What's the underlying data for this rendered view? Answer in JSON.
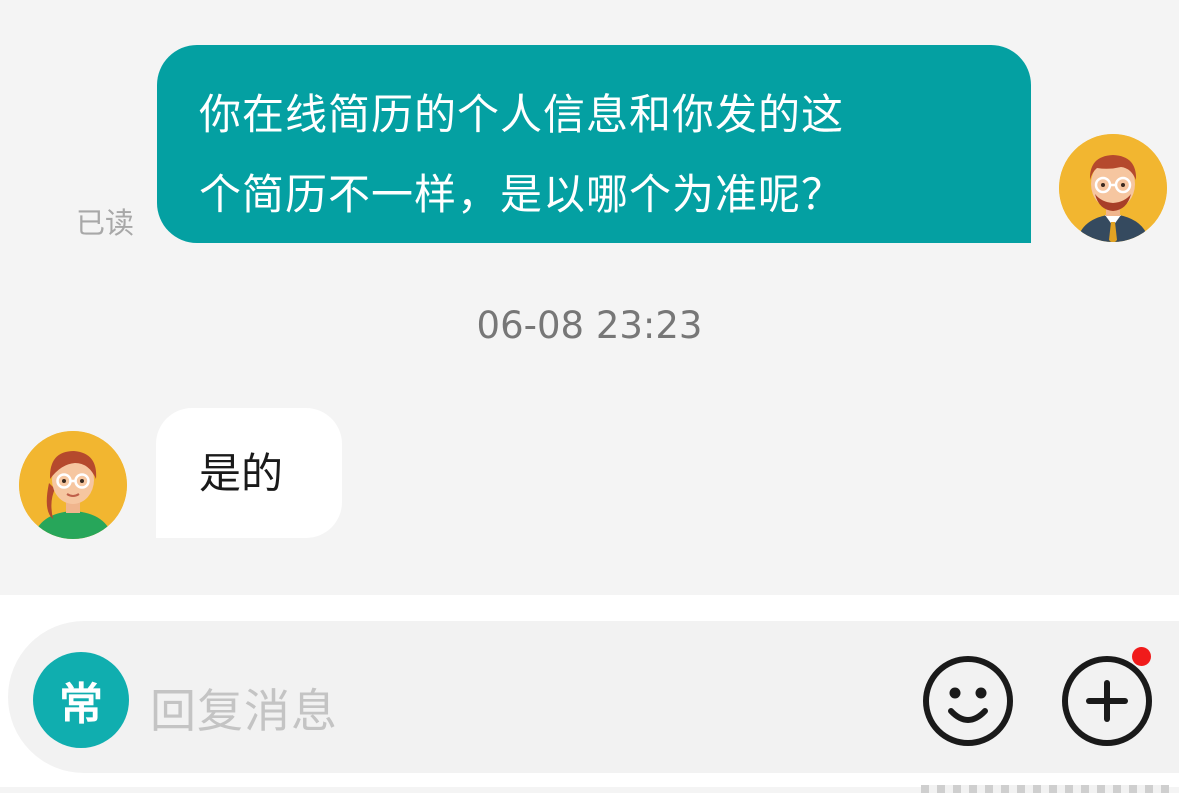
{
  "messages": {
    "outgoing": {
      "line1": "你在线简历的个人信息和你发的这",
      "line2": "个简历不一样，是以哪个为准呢？",
      "read_status": "已读",
      "bubble_color": "#04a0a2"
    },
    "timestamp": "06-08 23:23",
    "incoming": {
      "text": "是的"
    }
  },
  "input_bar": {
    "quick_reply_label": "常",
    "placeholder": "回复消息",
    "emoji_icon": "smiley-face-icon",
    "more_icon": "plus-circle-icon",
    "notification_dot_color": "#f01b1b"
  },
  "colors": {
    "accent": "#04a0a2",
    "avatar_bg": "#f2b630",
    "background": "#f4f4f4"
  }
}
